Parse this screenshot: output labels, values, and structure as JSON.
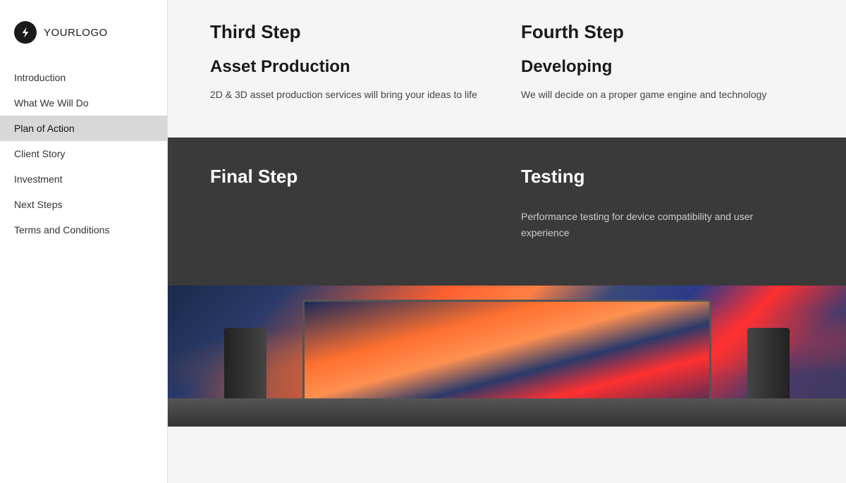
{
  "logo": {
    "icon_alt": "logo-icon",
    "text_bold": "YOUR",
    "text_light": "LOGO"
  },
  "sidebar": {
    "items": [
      {
        "id": "introduction",
        "label": "Introduction",
        "active": false
      },
      {
        "id": "what-we-will-do",
        "label": "What We Will Do",
        "active": false
      },
      {
        "id": "plan-of-action",
        "label": "Plan of Action",
        "active": true
      },
      {
        "id": "client-story",
        "label": "Client Story",
        "active": false
      },
      {
        "id": "investment",
        "label": "Investment",
        "active": false
      },
      {
        "id": "next-steps",
        "label": "Next Steps",
        "active": false
      },
      {
        "id": "terms-and-conditions",
        "label": "Terms and Conditions",
        "active": false
      }
    ]
  },
  "main": {
    "light_section": {
      "left_column": {
        "step_label": "Third Step",
        "step_title": "Asset Production",
        "step_desc": "2D & 3D asset production services will bring your ideas to life"
      },
      "right_column": {
        "step_label": "Fourth Step",
        "step_title": "Developing",
        "step_desc": "We will decide on a proper game engine and technology"
      }
    },
    "dark_section": {
      "left_column": {
        "step_label": "Final Step",
        "step_title": "",
        "step_desc": ""
      },
      "right_column": {
        "step_label": "Testing",
        "step_title": "",
        "step_desc": "Performance testing for device compatibility and user experience"
      }
    }
  }
}
